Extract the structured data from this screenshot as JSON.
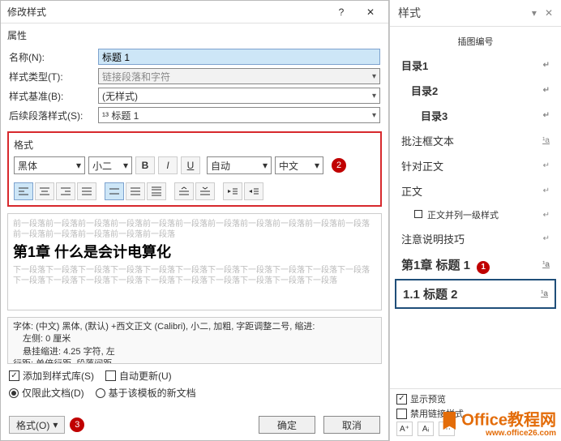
{
  "dialog": {
    "title": "修改样式",
    "section_props": "属性",
    "labels": {
      "name": "名称(N):",
      "style_type": "样式类型(T):",
      "based_on": "样式基准(B):",
      "follow": "后续段落样式(S):"
    },
    "values": {
      "name": "标题 1",
      "style_type": "链接段落和字符",
      "based_on": "(无样式)",
      "follow": "¹³ 标题 1"
    },
    "format_section": "格式",
    "font": "黑体",
    "size": "小二",
    "color": "自动",
    "script": "中文",
    "marker2": "2",
    "preview_gray_top": "前一段落前一段落前一段落前一段落前一段落前一段落前一段落前一段落前一段落前一段落前一段落前一段落前一段落前一段落前一段落前一段落",
    "preview_big": "第1章  什么是会计电算化",
    "preview_gray_bottom": "下一段落下一段落下一段落下一段落下一段落下一段落下一段落下一段落下一段落下一段落下一段落下一段落下一段落下一段落下一段落下一段落下一段落下一段落下一段落下一段落下一段落",
    "desc_line1": "字体: (中文) 黑体, (默认) +西文正文 (Calibri), 小二, 加粗, 字距调整二号, 缩进:",
    "desc_line2": "左侧: 0 厘米",
    "desc_line3": "悬挂缩进: 4.25 字符, 左",
    "desc_line4": "行距: 单倍行距, 段落间距",
    "chk_add": "添加到样式库(S)",
    "chk_auto": "自动更新(U)",
    "radio_doc": "仅限此文档(D)",
    "radio_tmpl": "基于该模板的新文档",
    "format_btn": "格式(O)",
    "marker3": "3",
    "ok": "确定",
    "cancel": "取消"
  },
  "panel": {
    "title": "样式",
    "caption": "插图编号",
    "items": {
      "toc1": "目录1",
      "toc2": "目录2",
      "toc3": "目录3",
      "comment": "批注框文本",
      "target": "针对正文",
      "body": "正文",
      "body_list": "正文并列一级样式",
      "note": "注意说明技巧",
      "heading1": "第1章 标题 1",
      "heading2": "1.1 标题 2"
    },
    "marker1": "1",
    "show_preview": "显示预览",
    "disable_link": "禁用链接样式"
  },
  "watermark": {
    "text": "Office教程网",
    "url": "www.office26.com"
  }
}
